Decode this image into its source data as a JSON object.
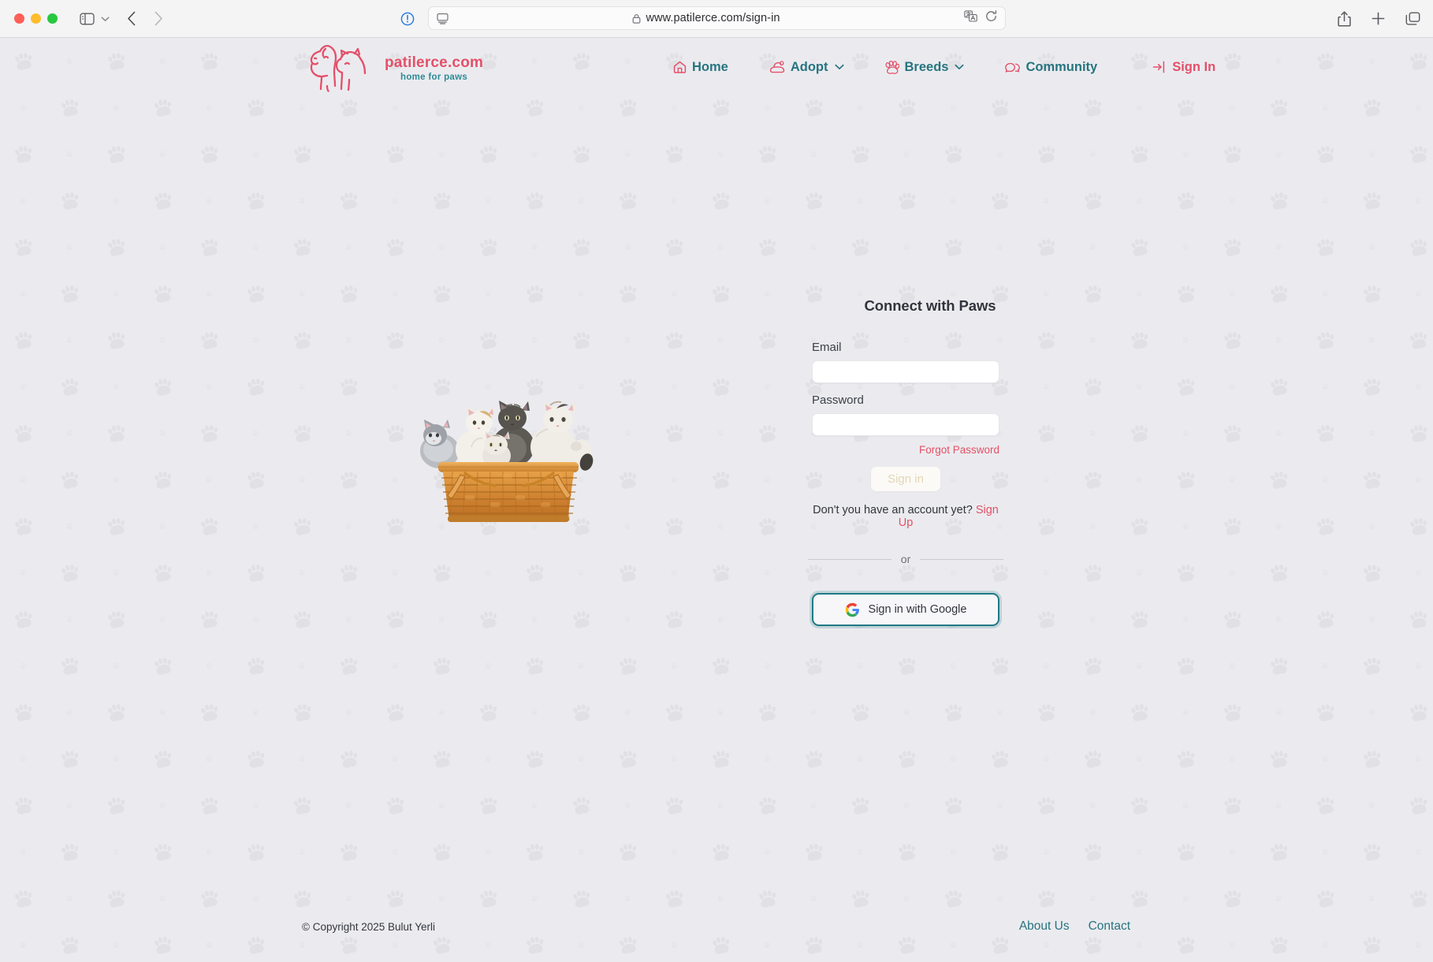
{
  "browser": {
    "url": "www.patilerce.com/sign-in",
    "icons": {
      "sidebar": "sidebar-icon",
      "sidebar_caret": "chevron-down-icon",
      "back": "back-arrow-icon",
      "forward": "forward-arrow-icon",
      "shield": "privacy-report-icon",
      "reader": "reader-view-icon",
      "lock": "lock-icon",
      "translate": "translate-icon",
      "reload": "reload-icon",
      "share": "share-icon",
      "new_tab": "plus-icon",
      "tab_overview": "tab-overview-icon"
    }
  },
  "site": {
    "logo": {
      "title": "patilerce.com",
      "tagline": "home for paws",
      "icon": "dog-and-cat-logo-icon",
      "title_color": "#e4506a",
      "tagline_color": "#2f8a96"
    },
    "nav": [
      {
        "label": "Home",
        "icon": "home-icon",
        "caret": false
      },
      {
        "label": "Adopt",
        "icon": "adopt-hands-icon",
        "caret": true
      },
      {
        "label": "Breeds",
        "icon": "paw-icon",
        "caret": true
      },
      {
        "label": "Community",
        "icon": "chat-bubbles-icon",
        "caret": false
      }
    ],
    "signin_nav": {
      "label": "Sign In",
      "icon": "sign-in-arrow-icon"
    },
    "nav_color": "#26747f",
    "accent_color": "#e4506a"
  },
  "hero": {
    "image": "kittens-in-basket-photo"
  },
  "auth": {
    "title": "Connect with Paws",
    "email": {
      "label": "Email",
      "value": "",
      "placeholder": ""
    },
    "password": {
      "label": "Password",
      "value": "",
      "placeholder": ""
    },
    "forgot_password": "Forgot Password",
    "submit": "Sign in",
    "signup_prompt": "Don't you have an account yet?",
    "signup_link": "Sign Up",
    "divider": "or",
    "google": {
      "label": "Sign in with Google",
      "icon": "google-g-icon"
    },
    "focus_ring_color": "#1f7a84"
  },
  "footer": {
    "copyright": "© Copyright 2025 Bulut Yerli",
    "links": [
      {
        "label": "About Us"
      },
      {
        "label": "Contact"
      }
    ]
  }
}
